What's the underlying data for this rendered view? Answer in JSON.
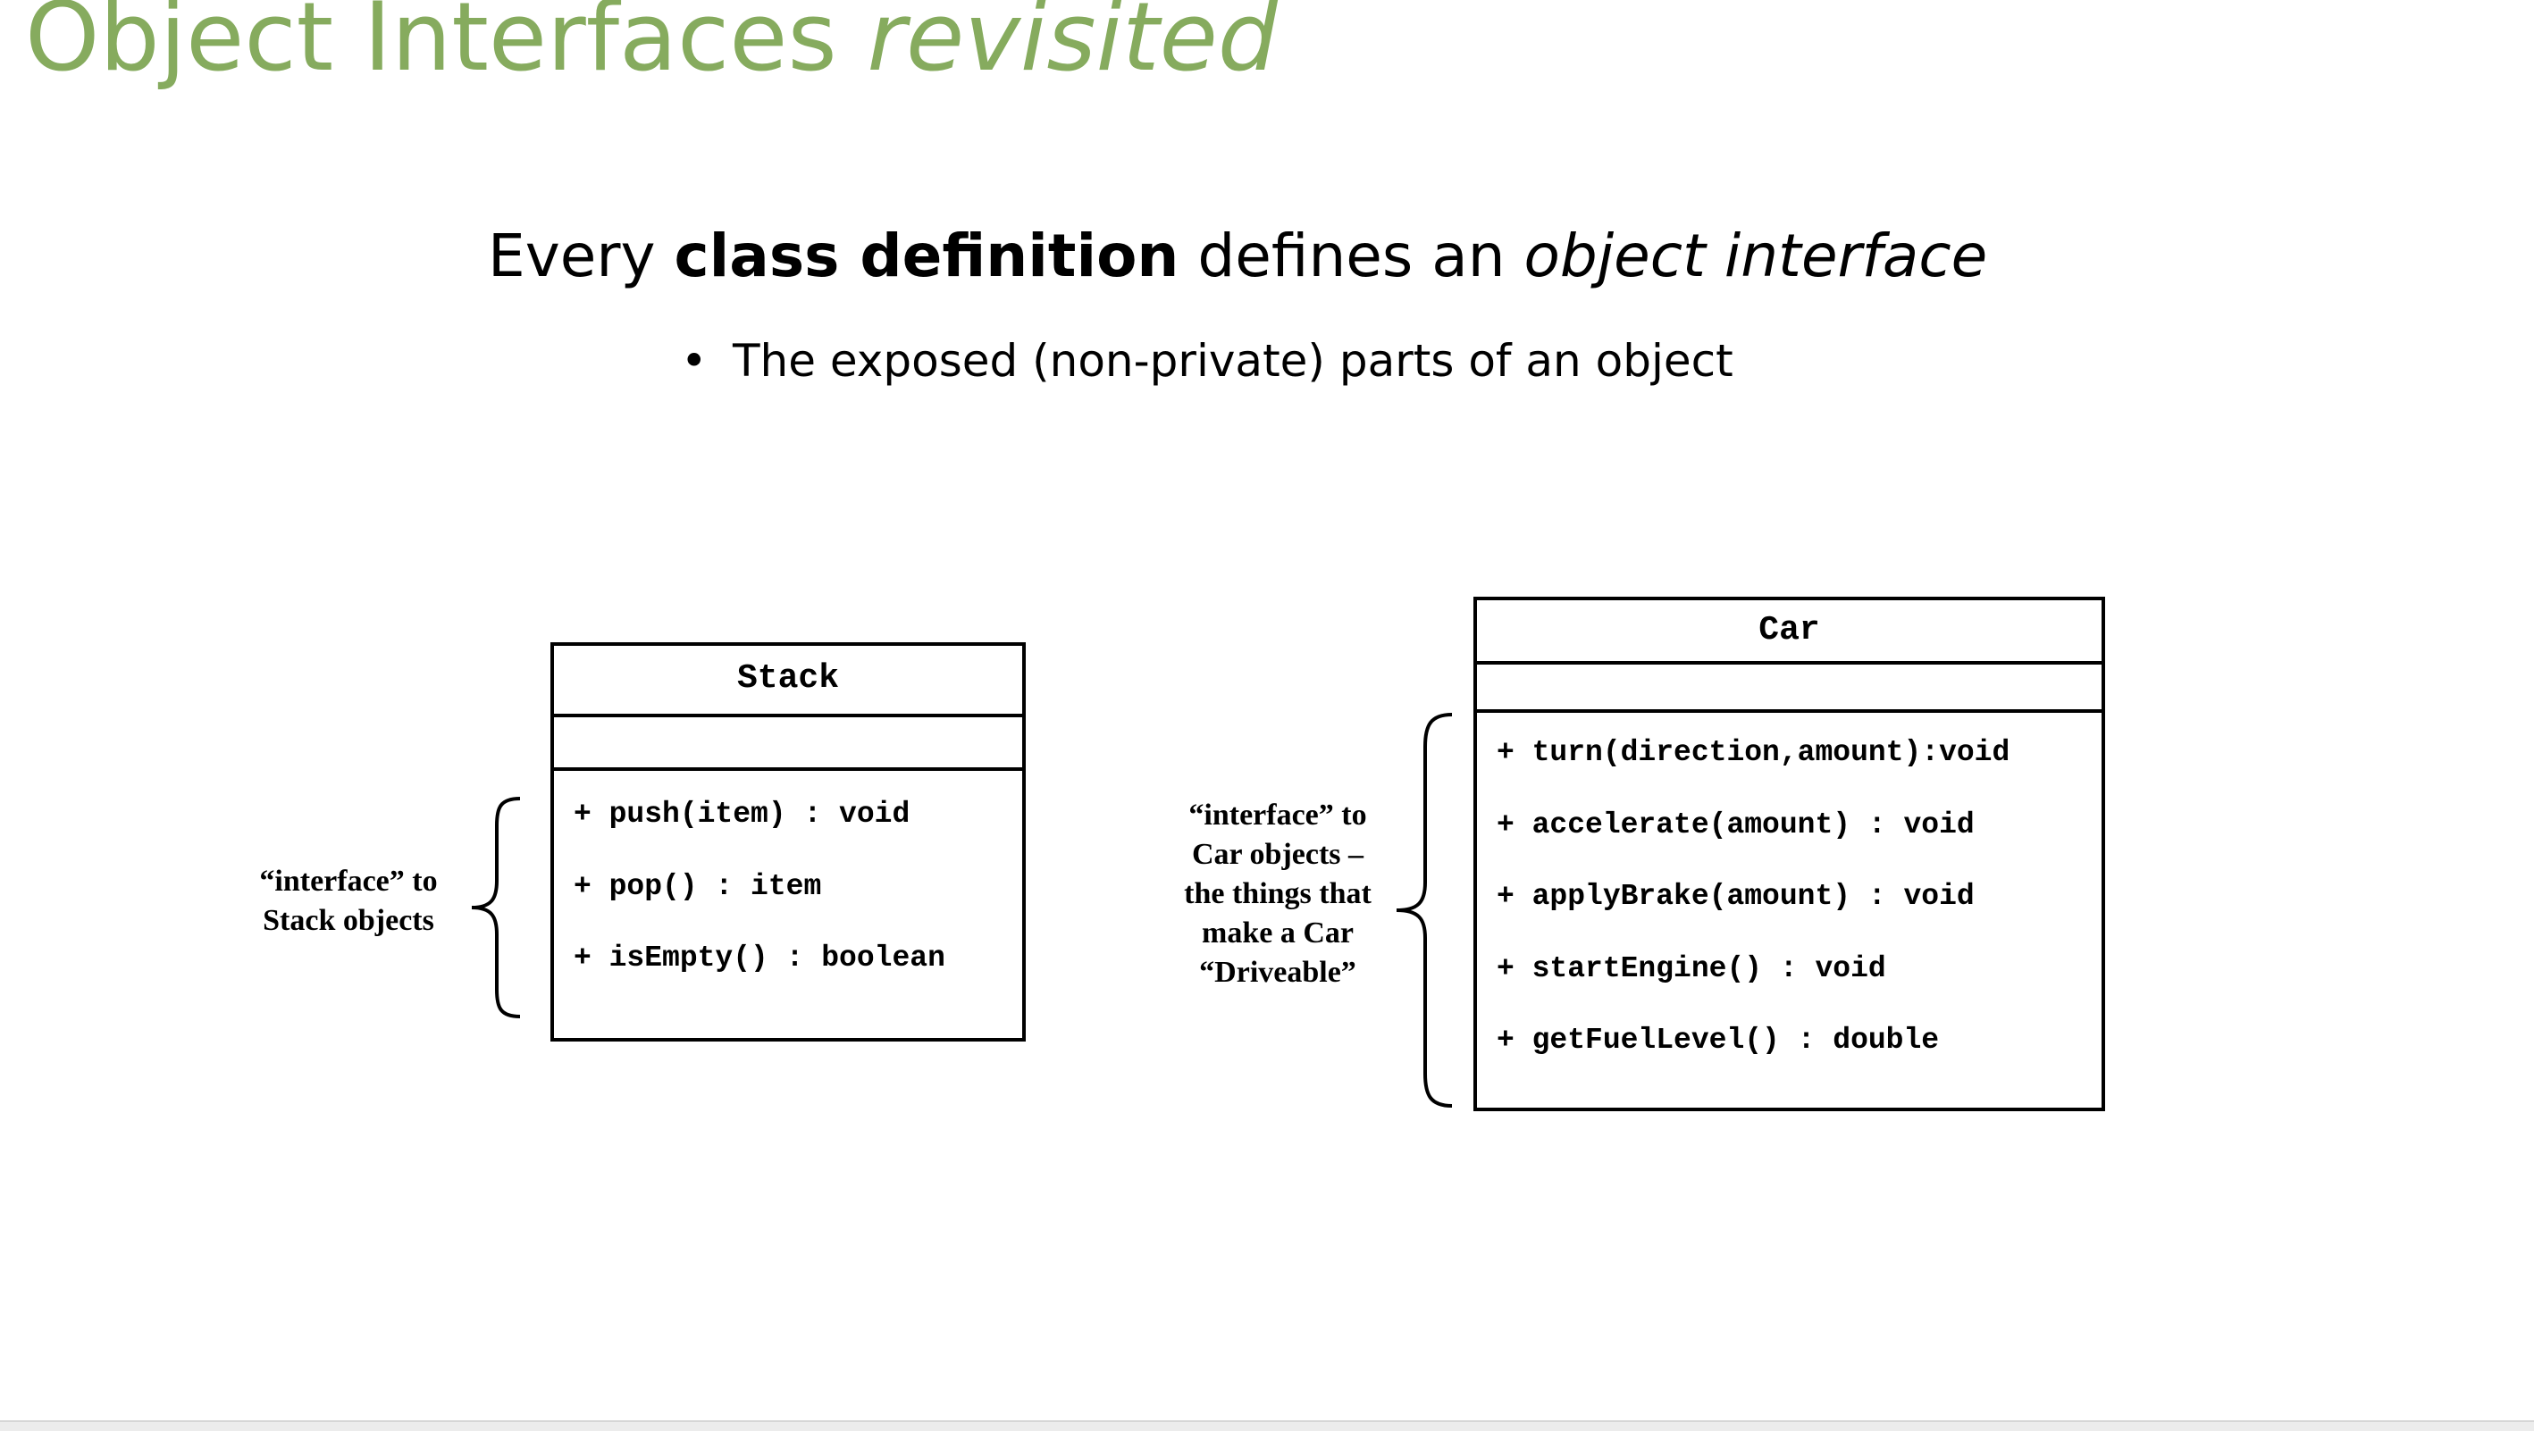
{
  "slide": {
    "title_plain": "Object Interfaces ",
    "title_italic": "revisited",
    "heading": {
      "part1": "Every ",
      "bold": "class definition",
      "part2": " defines an ",
      "italic": "object interface"
    },
    "bullet_dot": "•",
    "bullet_text": "The exposed (non-private) parts of an object"
  },
  "stack": {
    "class_name": "Stack",
    "operations": [
      "+ push(item) : void",
      "+ pop() : item",
      "+ isEmpty() : boolean"
    ],
    "note_lines": [
      "“interface” to",
      "Stack objects"
    ]
  },
  "car": {
    "class_name": "Car",
    "operations": [
      "+ turn(direction,amount):void",
      "+ accelerate(amount) : void",
      "+ applyBrake(amount) : void",
      "+ startEngine() : void",
      "+ getFuelLevel() : double"
    ],
    "note_lines": [
      "“interface” to",
      "Car objects –",
      "the things that",
      "make a Car",
      "“Driveable”"
    ]
  },
  "colors": {
    "title": "#86ab5e",
    "text": "#000000",
    "background": "#ffffff"
  }
}
